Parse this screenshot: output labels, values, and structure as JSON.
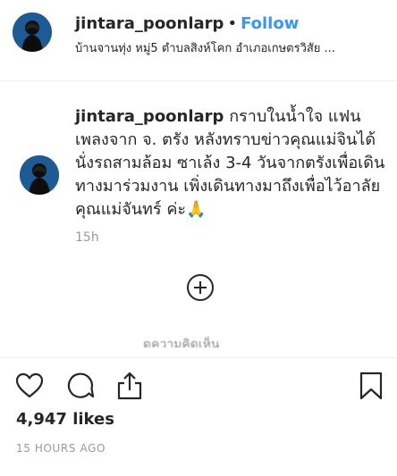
{
  "header": {
    "username": "jintara_poonlarp",
    "separator": "•",
    "follow_label": "Follow",
    "location": "บ้านจานทุ่ง หมู่5 ตำบลสิงห์โคก อำเภอเกษตรวิสัย ..."
  },
  "comment": {
    "username": "jintara_poonlarp",
    "text": "กราบในน้ำใจ แฟนเพลงจาก จ. ตรัง หลังทราบข่าวคุณแม่จินได้นั่งรถสามล้อม ซาเล้ง 3-4 วันจากตรังเพื่อเดินทางมาร่วมงาน เพิ่งเดินทางมาถึงเพื่อไว้อาลัย คุณแม่จันทร์ ค่ะ🙏",
    "time": "15h",
    "hidden_replies_partial": "ดูความคิดเห็น"
  },
  "actions": {
    "like_icon": "heart-outline",
    "comment_icon": "speech-bubble-outline",
    "share_icon": "share-upload",
    "save_icon": "bookmark-outline"
  },
  "post": {
    "likes": "4,947 likes",
    "time_ago": "15 HOURS AGO"
  },
  "colors": {
    "follow": "#3897f0",
    "text": "#262626",
    "muted": "#999999",
    "divider": "#efefef"
  }
}
